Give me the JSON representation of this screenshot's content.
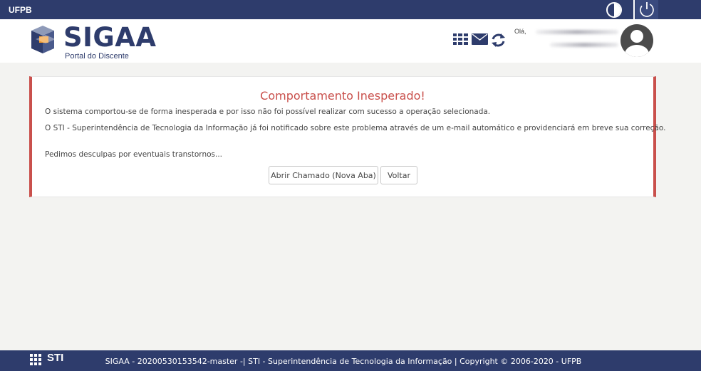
{
  "topbar": {
    "org": "UFPB",
    "contrast_icon": "contrast-icon",
    "power_icon": "power-icon"
  },
  "header": {
    "logo_text": "SIGAA",
    "logo_subtitle": "Portal do Discente",
    "icons": [
      "grid-menu-icon",
      "mail-icon",
      "refresh-icon"
    ],
    "greeting": "Olá,",
    "avatar_icon": "user-avatar-icon"
  },
  "error": {
    "title": "Comportamento Inesperado!",
    "line1": "O sistema comportou-se de forma inesperada e por isso não foi possível realizar com sucesso a operação selecionada.",
    "line2": "O STI - Superintendência de Tecnologia da Informação já foi notificado sobre este problema através de um e-mail automático e providenciará em breve sua correção.",
    "line3": "Pedimos desculpas por eventuais transtornos...",
    "open_ticket_label": "Abrir Chamado (Nova Aba)",
    "back_label": "Voltar"
  },
  "footer": {
    "sti_logo": "STI",
    "text": "SIGAA - 20200530153542-master -| STI - Superintendência de Tecnologia da Informação | Copyright © 2006-2020 - UFPB"
  },
  "colors": {
    "navy": "#2e3c6c",
    "error_red": "#c9504c",
    "page_bg": "#f3f3f1"
  }
}
